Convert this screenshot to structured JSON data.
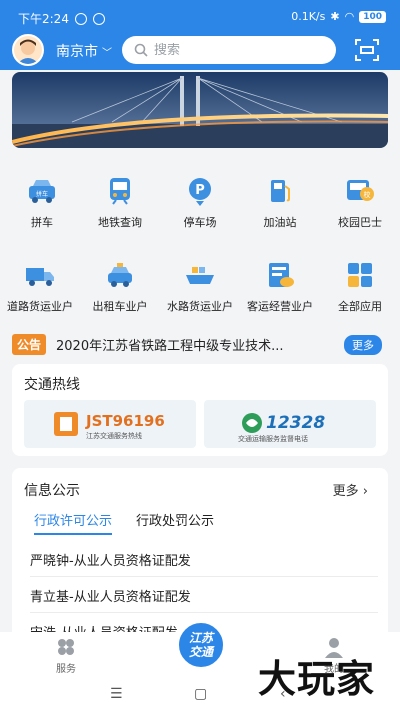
{
  "status_bar": {
    "time": "下午2:24",
    "speed": "0.1K/s",
    "battery": "100"
  },
  "header": {
    "city": "南京市",
    "search_placeholder": "搜索"
  },
  "services": [
    {
      "label": "拼车",
      "icon": "car-icon"
    },
    {
      "label": "地铁查询",
      "icon": "metro-icon"
    },
    {
      "label": "停车场",
      "icon": "parking-icon"
    },
    {
      "label": "加油站",
      "icon": "gas-station-icon"
    },
    {
      "label": "校园巴士",
      "icon": "school-bus-icon"
    },
    {
      "label": "道路货运业户",
      "icon": "truck-icon"
    },
    {
      "label": "出租车业户",
      "icon": "taxi-icon"
    },
    {
      "label": "水路货运业户",
      "icon": "ship-icon"
    },
    {
      "label": "客运经营业户",
      "icon": "passenger-icon"
    },
    {
      "label": "全部应用",
      "icon": "all-apps-icon"
    }
  ],
  "notice": {
    "tag": "公告",
    "text": "2020年江苏省铁路工程中级专业技术...",
    "more": "更多"
  },
  "hotline": {
    "title": "交通热线",
    "items": [
      {
        "number": "JST96196",
        "subtitle": "江苏交通服务热线"
      },
      {
        "number": "12328",
        "subtitle": "交通运输服务监督电话"
      }
    ]
  },
  "info": {
    "title": "信息公示",
    "more": "更多",
    "tabs": [
      "行政许可公示",
      "行政处罚公示"
    ],
    "items": [
      "严晓钟-从业人员资格证配发",
      "青立基-从业人员资格证配发",
      "宋浩-从业人员资格证配发"
    ]
  },
  "bottom_nav": {
    "left": "服务",
    "center": "江苏\n交通",
    "right": "我的"
  },
  "watermark": "大玩家",
  "colors": {
    "primary": "#2c86e8",
    "notice_tag": "#f08b2a"
  }
}
